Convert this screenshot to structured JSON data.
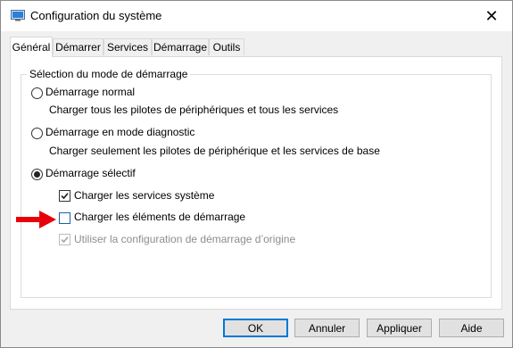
{
  "window": {
    "title": "Configuration du système",
    "close_glyph": "✕"
  },
  "tabs": [
    {
      "label": "Général",
      "active": true
    },
    {
      "label": "Démarrer",
      "active": false
    },
    {
      "label": "Services",
      "active": false
    },
    {
      "label": "Démarrage",
      "active": false
    },
    {
      "label": "Outils",
      "active": false
    }
  ],
  "group": {
    "title": "Sélection du mode de démarrage"
  },
  "options": {
    "normal": {
      "label": "Démarrage normal",
      "description": "Charger tous les pilotes de périphériques et tous les services",
      "selected": false
    },
    "diagnostic": {
      "label": "Démarrage en mode diagnostic",
      "description": "Charger seulement les pilotes de périphérique et les services de base",
      "selected": false
    },
    "selective": {
      "label": "Démarrage sélectif",
      "selected": true
    }
  },
  "checks": {
    "system_services": {
      "label": "Charger les services système",
      "checked": true
    },
    "startup_items": {
      "label": "Charger les éléments de démarrage",
      "checked": false
    },
    "original_config": {
      "label": "Utiliser la configuration de démarrage d’origine",
      "checked": true,
      "disabled": true
    }
  },
  "buttons": {
    "ok": "OK",
    "cancel": "Annuler",
    "apply": "Appliquer",
    "help": "Aide"
  },
  "annotation": {
    "arrow_color": "#e8000b"
  }
}
